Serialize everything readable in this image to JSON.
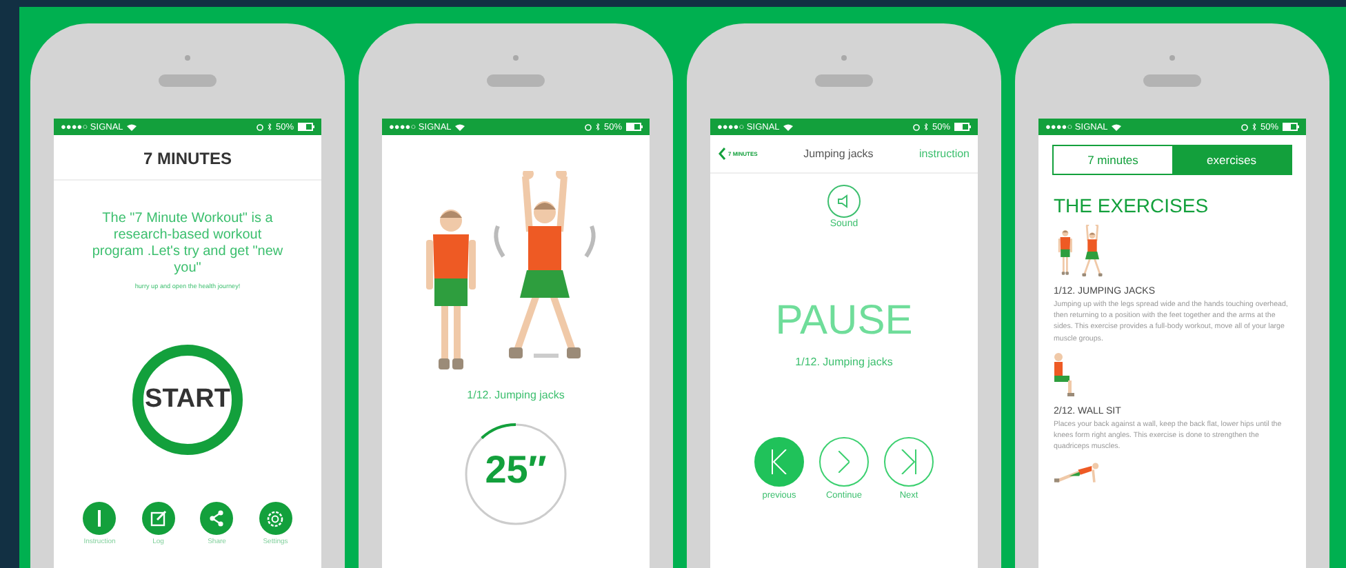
{
  "phones": [
    {
      "kind": "home",
      "status": {
        "carrier": "●●●●○ SIGNAL",
        "battery": "50%"
      },
      "title": "7 MINUTES",
      "intro": "The \"7 Minute Workout\" is a research-based workout program .Let's try and get \"new you\"",
      "tagline": "hurry up and open the health journey!",
      "start": "START",
      "actions": [
        {
          "kind": "info",
          "label": "Instruction"
        },
        {
          "kind": "log",
          "label": "Log"
        },
        {
          "kind": "share",
          "label": "Share"
        },
        {
          "kind": "settings",
          "label": "Settings"
        }
      ]
    },
    {
      "kind": "exercise",
      "status": {
        "carrier": "●●●●○ SIGNAL",
        "battery": "50%"
      },
      "exercise": "1/12. Jumping jacks",
      "timer": "25″",
      "level": 0.12
    },
    {
      "kind": "pause",
      "status": {
        "carrier": "●●●●○ SIGNAL",
        "battery": "50%"
      },
      "back": "7 MINUTES",
      "title": "Jumping jacks",
      "link": "instruction",
      "sound": "Sound",
      "pause": "PAUSE",
      "exercise": "1/12. Jumping jacks",
      "controls": [
        {
          "kind": "previous",
          "label": "previous",
          "selected": true
        },
        {
          "kind": "continue",
          "label": "Continue",
          "selected": false
        },
        {
          "kind": "next",
          "label": "Next",
          "selected": false
        }
      ]
    },
    {
      "kind": "list",
      "status": {
        "carrier": "●●●●○ SIGNAL",
        "battery": "50%"
      },
      "tabs": [
        {
          "label": "7 minutes",
          "selected": false
        },
        {
          "label": "exercises",
          "selected": true
        }
      ],
      "heading": "THE EXERCISES",
      "items": [
        {
          "kind": "jumping",
          "title": "1/12. JUMPING JACKS",
          "description": "Jumping up with the legs spread wide and the hands touching overhead, then returning to a position with the feet together and the arms at the sides. This exercise provides a full-body workout, move all of your large muscle groups."
        },
        {
          "kind": "wallsit",
          "title": "2/12. WALL SIT",
          "description": "Places your back against a wall, keep the back flat, lower hips until the knees form right angles. This exercise is done to strengthen the quadriceps muscles."
        },
        {
          "kind": "pushup"
        }
      ]
    }
  ]
}
